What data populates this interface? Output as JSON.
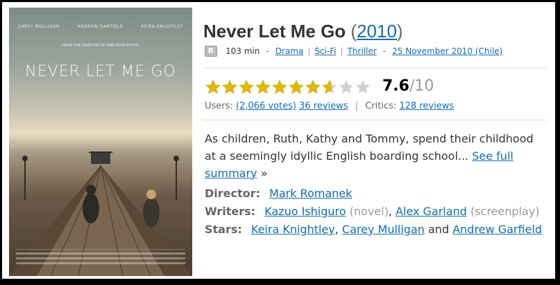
{
  "poster": {
    "billing": [
      "CAREY MULLIGAN",
      "ANDREW GARFIELD",
      "KEIRA KNIGHTLEY"
    ],
    "tagline": "FROM THE DIRECTOR OF ONE HOUR PHOTO",
    "title": "NEVER LET ME GO"
  },
  "movie": {
    "title": "Never Let Me Go",
    "paren_open": "(",
    "year": "2010",
    "paren_close": ")",
    "certificate": "R",
    "runtime": "103 min",
    "dash1": "-",
    "genres": [
      "Drama",
      "Sci-Fi",
      "Thriller"
    ],
    "genre_sep": "|",
    "dash2": "-",
    "release": "25 November 2010 (Chile)"
  },
  "rating": {
    "score": "7.6",
    "denominator": "/10",
    "value": 7.6,
    "max": 10,
    "users_label": "Users:",
    "votes": "(2,066 votes)",
    "user_reviews": "36 reviews",
    "sep": "|",
    "critics_label": "Critics:",
    "critic_reviews": "128 reviews",
    "star_color": "#e5b800",
    "empty_star_color": "#d0d0d0"
  },
  "plot": {
    "text": "As children, Ruth, Kathy and Tommy, spend their childhood at a seemingly idyllic English boarding school... ",
    "link": "See full summary",
    "suffix": " »"
  },
  "credits": {
    "director_label": "Director:",
    "director": "Mark Romanek",
    "writers_label": "Writers:",
    "writer1": "Kazuo Ishiguro",
    "writer1_role": "(novel)",
    "comma": ",",
    "writer2": "Alex Garland",
    "writer2_role": "(screenplay)",
    "stars_label": "Stars:",
    "star1": "Keira Knightley",
    "star2": "Carey Mulligan",
    "and": "and",
    "star3": "Andrew Garfield"
  }
}
